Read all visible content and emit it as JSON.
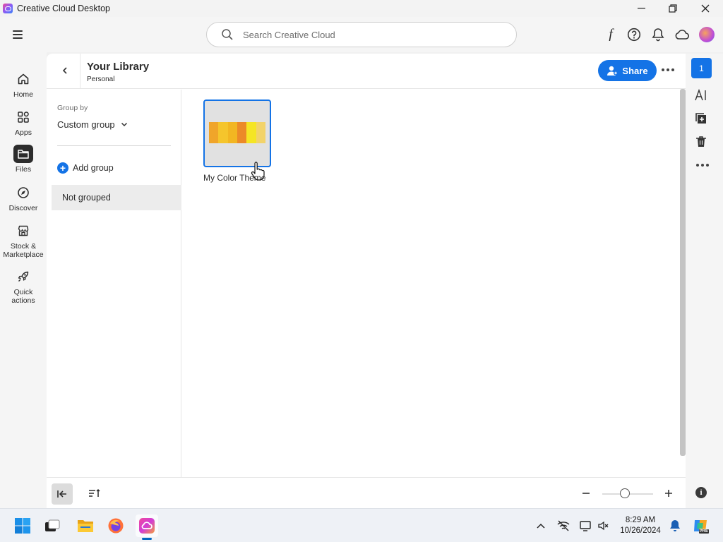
{
  "window": {
    "title": "Creative Cloud Desktop",
    "controls": {
      "minimize": "—",
      "restore": "❐",
      "close": "✕"
    }
  },
  "topbar": {
    "search_placeholder": "Search Creative Cloud",
    "icons": [
      "fonts-icon",
      "help-icon",
      "bell-icon",
      "cloud-icon",
      "avatar"
    ]
  },
  "sidebar": {
    "items": [
      {
        "label": "Home",
        "icon": "home-icon",
        "active": false
      },
      {
        "label": "Apps",
        "icon": "apps-icon",
        "active": false
      },
      {
        "label": "Files",
        "icon": "folder-icon",
        "active": true
      },
      {
        "label": "Discover",
        "icon": "compass-icon",
        "active": false
      },
      {
        "label": "Stock & Marketplace",
        "icon": "store-icon",
        "active": false
      },
      {
        "label": "Quick actions",
        "icon": "rocket-icon",
        "active": false
      }
    ]
  },
  "library": {
    "title": "Your Library",
    "subtitle": "Personal",
    "share_label": "Share"
  },
  "groups": {
    "group_by_label": "Group by",
    "group_by_value": "Custom group",
    "add_group_label": "Add group",
    "not_grouped_label": "Not grouped"
  },
  "assets": [
    {
      "name": "My Color Theme",
      "type": "color-theme",
      "colors": [
        "#F0A52A",
        "#F5C52C",
        "#F2B622",
        "#EC8A28",
        "#F5E524",
        "#F2D36A"
      ]
    }
  ],
  "right_rail": {
    "badge_count": "1",
    "icons": [
      "text-style-icon",
      "add-to-library-icon",
      "trash-icon",
      "more-icon"
    ]
  },
  "bottombar": {
    "zoom_level_fraction": 0.45
  },
  "taskbar": {
    "apps": [
      "windows-start",
      "task-view",
      "file-explorer",
      "firefox",
      "creative-cloud"
    ],
    "time": "8:29 AM",
    "date": "10/26/2024",
    "copilot_label": "PRE"
  }
}
